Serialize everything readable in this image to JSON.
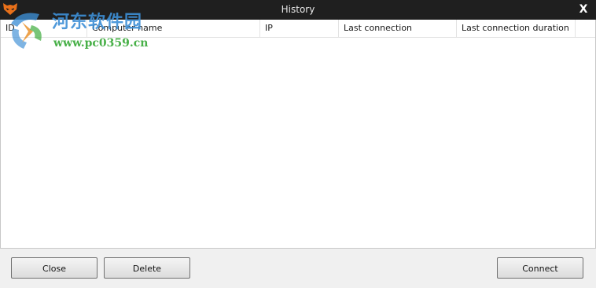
{
  "window": {
    "title": "History",
    "close_glyph": "X",
    "app_icon": "orange-fox-icon"
  },
  "watermark": {
    "site_name": "河东软件园",
    "url": "www.pc0359.cn"
  },
  "table": {
    "columns": [
      "ID",
      "Computer name",
      "IP",
      "Last connection",
      "Last connection duration"
    ],
    "rows": []
  },
  "buttons": {
    "close_label": "Close",
    "delete_label": "Delete",
    "connect_label": "Connect"
  },
  "colors": {
    "titlebar": "#1f1f1f",
    "window_bg": "#f0f0f0",
    "list_bg": "#ffffff",
    "watermark_blue": "#3d8fd6",
    "watermark_green": "#35a835",
    "app_icon_orange": "#e8701a"
  }
}
